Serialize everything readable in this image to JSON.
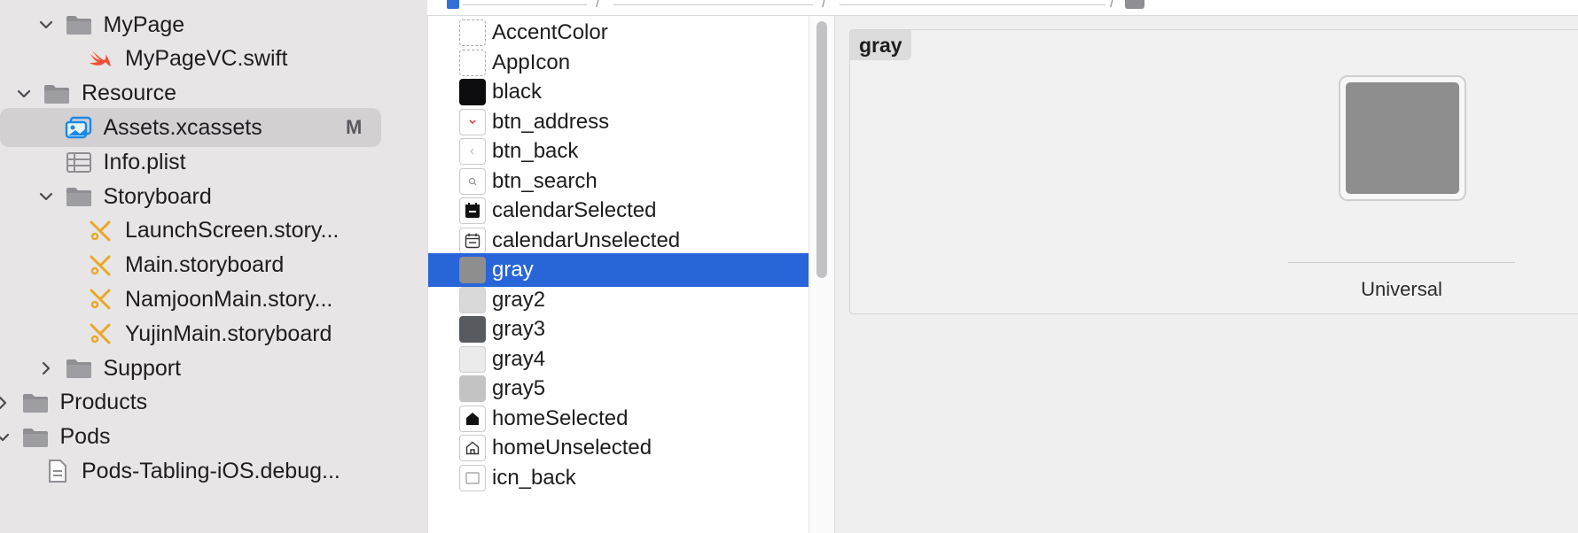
{
  "navigator": {
    "items": [
      {
        "label": "MyPage",
        "indent": 3,
        "expanded": true,
        "kind": "folder",
        "icon": "folder-icon"
      },
      {
        "label": "MyPageVC.swift",
        "indent": 4,
        "kind": "swift",
        "icon": "swift-file-icon"
      },
      {
        "label": "Resource",
        "indent": 2,
        "expanded": true,
        "kind": "folder",
        "icon": "folder-icon"
      },
      {
        "label": "Assets.xcassets",
        "indent": 3,
        "kind": "assets",
        "icon": "asset-catalog-icon",
        "selected": true,
        "badge": "M"
      },
      {
        "label": "Info.plist",
        "indent": 3,
        "kind": "plist",
        "icon": "plist-icon"
      },
      {
        "label": "Storyboard",
        "indent": 3,
        "expanded": true,
        "kind": "folder",
        "icon": "folder-icon"
      },
      {
        "label": "LaunchScreen.story...",
        "indent": 4,
        "kind": "storyboard",
        "icon": "storyboard-icon"
      },
      {
        "label": "Main.storyboard",
        "indent": 4,
        "kind": "storyboard",
        "icon": "storyboard-icon"
      },
      {
        "label": "NamjoonMain.story...",
        "indent": 4,
        "kind": "storyboard",
        "icon": "storyboard-icon"
      },
      {
        "label": "YujinMain.storyboard",
        "indent": 4,
        "kind": "storyboard",
        "icon": "storyboard-icon"
      },
      {
        "label": "Support",
        "indent": 3,
        "expanded": false,
        "kind": "folder",
        "icon": "folder-icon"
      },
      {
        "label": "Products",
        "indent": 1,
        "expanded": false,
        "kind": "folder",
        "icon": "folder-icon"
      },
      {
        "label": "Pods",
        "indent": 1,
        "expanded": true,
        "kind": "folder",
        "icon": "folder-icon"
      },
      {
        "label": "Pods-Tabling-iOS.debug...",
        "indent": 2,
        "kind": "file",
        "icon": "file-icon"
      }
    ]
  },
  "assets": {
    "items": [
      {
        "label": "AccentColor",
        "thumb": "dashed"
      },
      {
        "label": "AppIcon",
        "thumb": "dashed"
      },
      {
        "label": "black",
        "thumb": "color",
        "color": "#0c0c0e"
      },
      {
        "label": "btn_address",
        "thumb": "image",
        "icon": "chevron-down-red-icon"
      },
      {
        "label": "btn_back",
        "thumb": "image",
        "icon": "chevron-left-icon"
      },
      {
        "label": "btn_search",
        "thumb": "image",
        "icon": "search-icon"
      },
      {
        "label": "calendarSelected",
        "thumb": "image",
        "icon": "calendar-filled-icon"
      },
      {
        "label": "calendarUnselected",
        "thumb": "image",
        "icon": "calendar-outline-icon"
      },
      {
        "label": "gray",
        "thumb": "color",
        "color": "#8e8e8e",
        "selected": true
      },
      {
        "label": "gray2",
        "thumb": "color",
        "color": "#d9d9d9"
      },
      {
        "label": "gray3",
        "thumb": "color",
        "color": "#575a5e"
      },
      {
        "label": "gray4",
        "thumb": "color",
        "color": "#ebebeb"
      },
      {
        "label": "gray5",
        "thumb": "color",
        "color": "#c3c3c3"
      },
      {
        "label": "homeSelected",
        "thumb": "image",
        "icon": "home-filled-icon"
      },
      {
        "label": "homeUnselected",
        "thumb": "image",
        "icon": "home-outline-icon"
      },
      {
        "label": "icn_back",
        "thumb": "image",
        "icon": "image-icon"
      }
    ]
  },
  "editor": {
    "set_name": "gray",
    "swatch_color": "#8e8e8e",
    "appearance_label": "Universal"
  },
  "colors": {
    "selection": "#2765d9",
    "swift_orange": "#f05138",
    "storyboard_yellow": "#e9a824",
    "folder_gray": "#8e8e93"
  }
}
